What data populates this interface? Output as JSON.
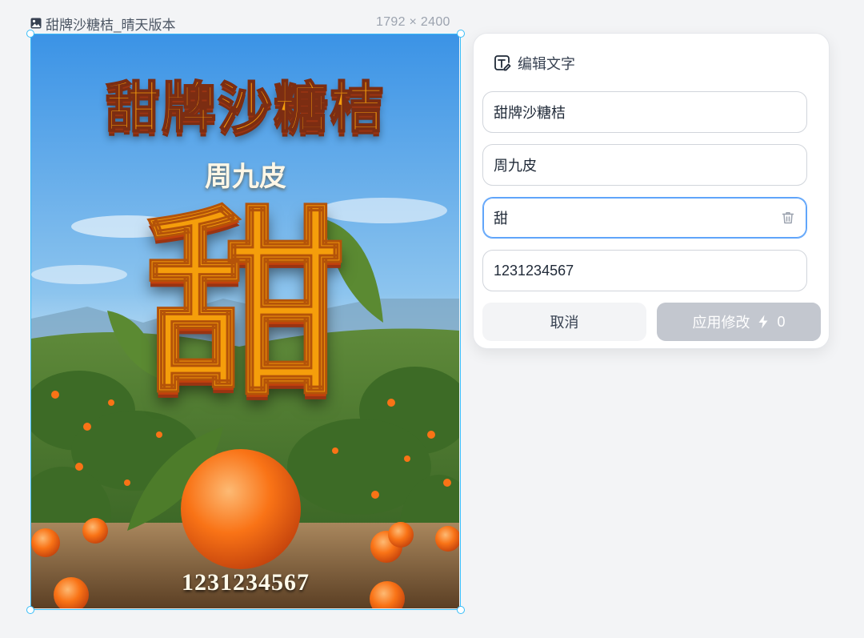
{
  "canvas": {
    "file_title": "甜牌沙糖桔_晴天版本",
    "dimensions": "1792 × 2400",
    "accent_color": "#38bdf8"
  },
  "poster": {
    "title": "甜牌沙糖桔",
    "subtitle": "周九皮",
    "big_char": "甜",
    "phone": "1231234567"
  },
  "panel": {
    "title": "编辑文字",
    "fields": [
      {
        "value": "甜牌沙糖桔"
      },
      {
        "value": "周九皮"
      },
      {
        "value": "甜",
        "active": true
      },
      {
        "value": "1231234567"
      }
    ],
    "cancel_label": "取消",
    "apply_label": "应用修改",
    "apply_cost": "0"
  },
  "icons": [
    "image-icon",
    "text-edit-icon",
    "trash-icon",
    "bolt-icon"
  ]
}
